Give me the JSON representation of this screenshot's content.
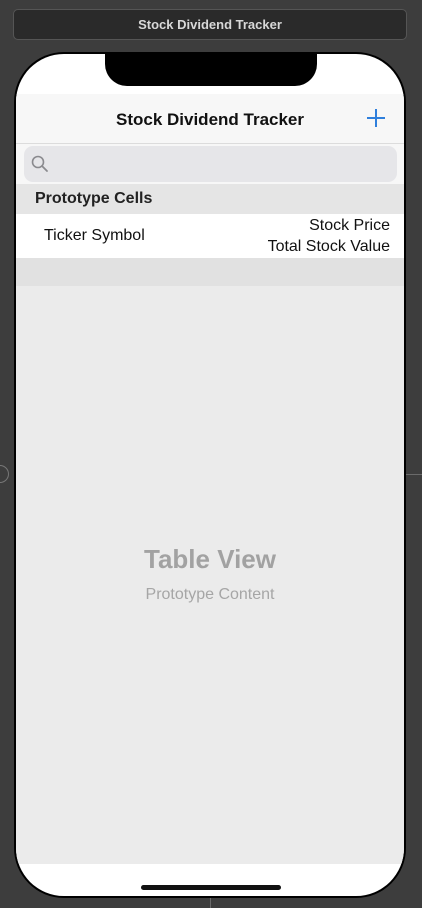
{
  "scene": {
    "title": "Stock Dividend Tracker"
  },
  "navbar": {
    "title": "Stock Dividend Tracker",
    "add_icon": "plus-icon"
  },
  "search": {
    "placeholder": "",
    "icon": "magnifying-glass-icon"
  },
  "table": {
    "section_header": "Prototype Cells",
    "cell": {
      "left_label": "Ticker Symbol",
      "right_top": "Stock Price",
      "right_bottom": "Total Stock Value"
    },
    "placeholder_title": "Table View",
    "placeholder_subtitle": "Prototype Content"
  },
  "colors": {
    "accent": "#2f7fdc",
    "background": "#3d3d3d"
  }
}
